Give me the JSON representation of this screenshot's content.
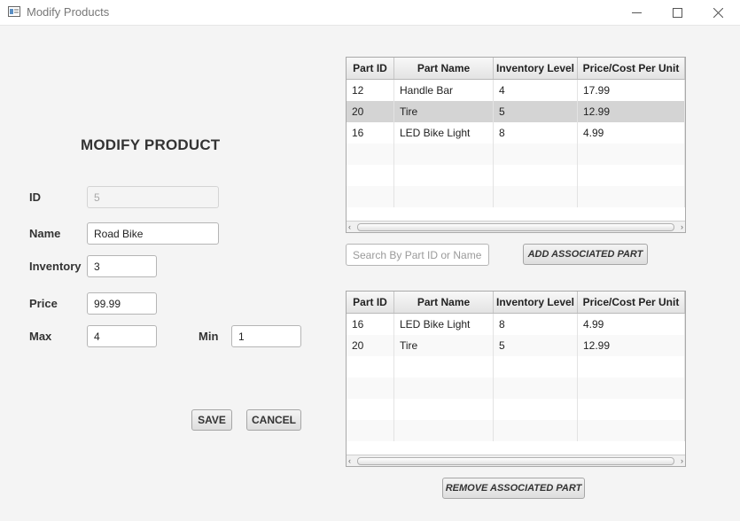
{
  "window": {
    "title": "Modify Products"
  },
  "form": {
    "heading": "MODIFY PRODUCT",
    "id_label": "ID",
    "id_value": "5",
    "name_label": "Name",
    "name_value": "Road Bike",
    "inventory_label": "Inventory",
    "inventory_value": "3",
    "price_label": "Price",
    "price_value": "99.99",
    "max_label": "Max",
    "max_value": "4",
    "min_label": "Min",
    "min_value": "1",
    "save_label": "SAVE",
    "cancel_label": "CANCEL"
  },
  "search": {
    "placeholder": "Search By Part ID or Name",
    "add_label": "ADD ASSOCIATED PART"
  },
  "columns": [
    "Part ID",
    "Part Name",
    "Inventory Level",
    "Price/Cost Per Unit"
  ],
  "parts_table": {
    "rows": [
      [
        "12",
        "Handle Bar",
        "4",
        "17.99"
      ],
      [
        "20",
        "Tire",
        "5",
        "12.99"
      ],
      [
        "16",
        "LED Bike Light",
        "8",
        "4.99"
      ]
    ],
    "selected_row": 1
  },
  "associated_table": {
    "rows": [
      [
        "16",
        "LED Bike Light",
        "8",
        "4.99"
      ],
      [
        "20",
        "Tire",
        "5",
        "12.99"
      ]
    ]
  },
  "remove_label": "REMOVE ASSOCIATED PART",
  "icons": {
    "app": "window-app-icon",
    "minimize": "minimize-icon",
    "maximize": "maximize-icon",
    "close": "close-icon"
  }
}
